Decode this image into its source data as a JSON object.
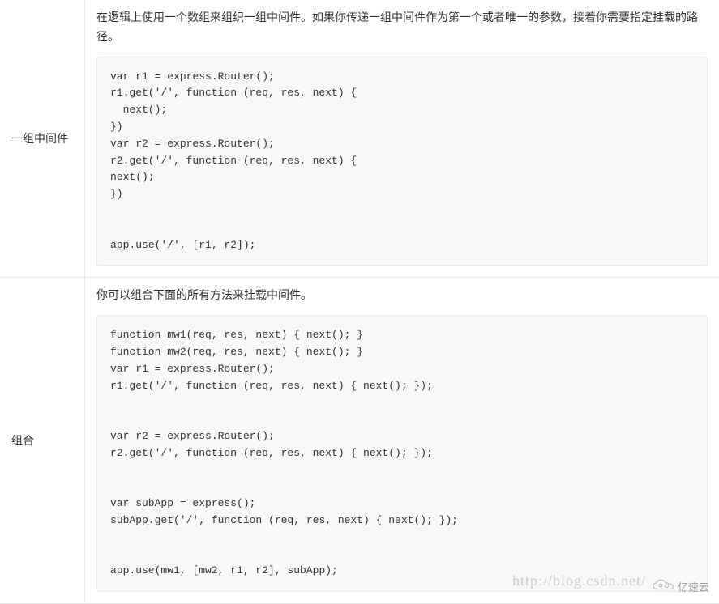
{
  "rows": [
    {
      "label": "一组中间件",
      "description": "在逻辑上使用一个数组来组织一组中间件。如果你传递一组中间件作为第一个或者唯一的参数，接着你需要指定挂载的路径。",
      "code": "var r1 = express.Router();\nr1.get('/', function (req, res, next) {\n  next();\n})\nvar r2 = express.Router();\nr2.get('/', function (req, res, next) {\nnext();\n})\n\n\napp.use('/', [r1, r2]);"
    },
    {
      "label": "组合",
      "description": "你可以组合下面的所有方法来挂载中间件。",
      "code": "function mw1(req, res, next) { next(); }\nfunction mw2(req, res, next) { next(); }\nvar r1 = express.Router();\nr1.get('/', function (req, res, next) { next(); });\n\n\nvar r2 = express.Router();\nr2.get('/', function (req, res, next) { next(); });\n\n\nvar subApp = express();\nsubApp.get('/', function (req, res, next) { next(); });\n\n\napp.use(mw1, [mw2, r1, r2], subApp);"
    }
  ],
  "watermark_text": "http://blog.csdn.net/",
  "logo_text": "亿速云"
}
